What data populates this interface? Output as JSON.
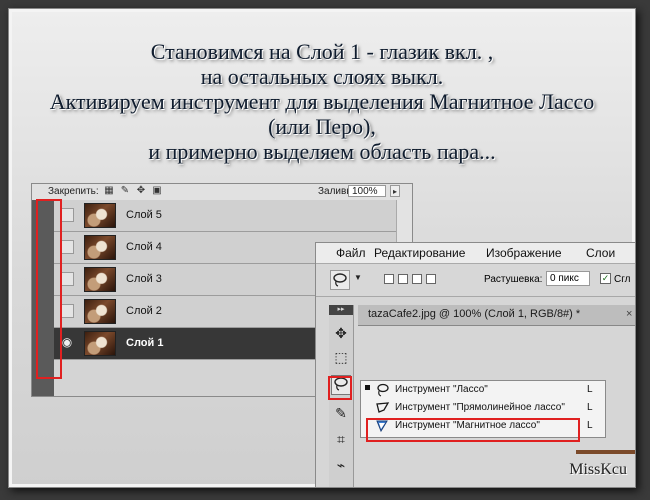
{
  "instructions": [
    "Становимся на Слой 1 - глазик вкл. ,",
    "на остальных слоях выкл.",
    "Активируем инструмент для выделения Магнитное Лассо",
    "(или Перо),",
    "и примерно выделяем область пара..."
  ],
  "signature": "MissKcu",
  "layers_panel": {
    "lock_label": "Закрепить:",
    "fill_label": "Заливка:",
    "fill_value": "100%",
    "layers": [
      {
        "name": "Слой 5",
        "visible": false,
        "active": false
      },
      {
        "name": "Слой 4",
        "visible": false,
        "active": false
      },
      {
        "name": "Слой 3",
        "visible": false,
        "active": false
      },
      {
        "name": "Слой 2",
        "visible": false,
        "active": false
      },
      {
        "name": "Слой 1",
        "visible": true,
        "active": true
      }
    ]
  },
  "ps_window": {
    "menu": [
      "Файл",
      "Редактирование",
      "Изображение",
      "Слои"
    ],
    "feather_label": "Растушевка:",
    "feather_value": "0 пикс",
    "antialias_label": "Сгл",
    "document_tab": "tazaCafe2.jpg @ 100% (Слой 1, RGB/8#) *",
    "tab_close": "×",
    "lasso_flyout": [
      {
        "label": "Инструмент \"Лассо\"",
        "key": "L",
        "icon": "lasso-icon",
        "current": true
      },
      {
        "label": "Инструмент \"Прямолинейное лассо\"",
        "key": "L",
        "icon": "polygonal-lasso-icon",
        "current": false
      },
      {
        "label": "Инструмент \"Магнитное лассо\"",
        "key": "L",
        "icon": "magnetic-lasso-icon",
        "current": false
      }
    ]
  },
  "accent_color": "#e02020"
}
